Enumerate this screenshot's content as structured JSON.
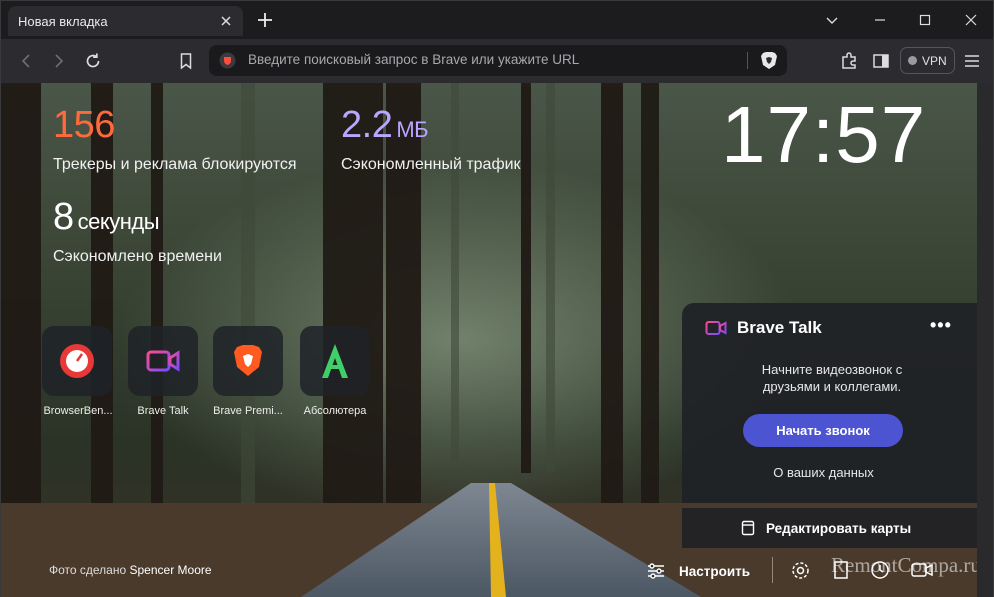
{
  "tab": {
    "title": "Новая вкладка"
  },
  "urlbar": {
    "placeholder": "Введите поисковый запрос в Brave или укажите URL"
  },
  "vpn": {
    "label": "VPN"
  },
  "stats": {
    "trackers": {
      "value": "156",
      "label": "Трекеры и реклама блокируются",
      "color": "#ff6a3d"
    },
    "bandwidth": {
      "value": "2.2",
      "unit": "МБ",
      "label": "Сэкономленный трафик",
      "color": "#b8a6ff"
    },
    "time": {
      "value": "8",
      "unit": "секунды",
      "label": "Сэкономлено времени"
    }
  },
  "clock": {
    "time": "17:57"
  },
  "top_sites": [
    {
      "label": "BrowserBen...",
      "icon": "speedometer-icon"
    },
    {
      "label": "Brave Talk",
      "icon": "video-camera-icon"
    },
    {
      "label": "Brave Premi...",
      "icon": "brave-lion-icon"
    },
    {
      "label": "Абсолютера",
      "icon": "letter-a-icon"
    }
  ],
  "brave_talk": {
    "title": "Brave Talk",
    "menu": "•••",
    "description": "Начните видеозвонок с друзьями и коллегами.",
    "button": "Начать звонок",
    "link": "О ваших данных"
  },
  "edit_cards": {
    "label": "Редактировать карты"
  },
  "footer": {
    "credit_prefix": "Фото сделано",
    "credit_author": "Spencer Moore",
    "customize": "Настроить"
  },
  "watermark": "RemontCompa.ru"
}
